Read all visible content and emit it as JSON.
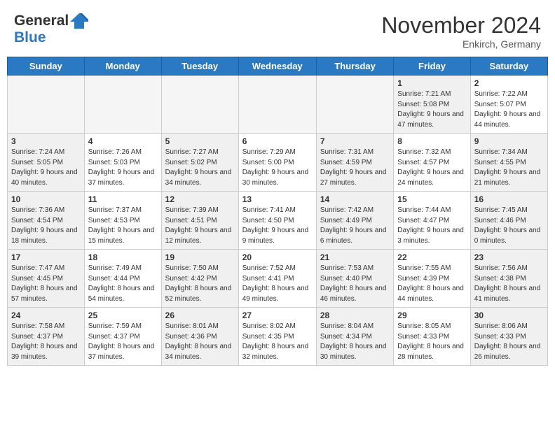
{
  "header": {
    "logo_line1": "General",
    "logo_line2": "Blue",
    "month_title": "November 2024",
    "location": "Enkirch, Germany"
  },
  "days_of_week": [
    "Sunday",
    "Monday",
    "Tuesday",
    "Wednesday",
    "Thursday",
    "Friday",
    "Saturday"
  ],
  "weeks": [
    [
      {
        "day": "",
        "info": "",
        "empty": true
      },
      {
        "day": "",
        "info": "",
        "empty": true
      },
      {
        "day": "",
        "info": "",
        "empty": true
      },
      {
        "day": "",
        "info": "",
        "empty": true
      },
      {
        "day": "",
        "info": "",
        "empty": true
      },
      {
        "day": "1",
        "info": "Sunrise: 7:21 AM\nSunset: 5:08 PM\nDaylight: 9 hours and 47 minutes.",
        "empty": false,
        "shaded": true
      },
      {
        "day": "2",
        "info": "Sunrise: 7:22 AM\nSunset: 5:07 PM\nDaylight: 9 hours and 44 minutes.",
        "empty": false
      }
    ],
    [
      {
        "day": "3",
        "info": "Sunrise: 7:24 AM\nSunset: 5:05 PM\nDaylight: 9 hours and 40 minutes.",
        "empty": false,
        "shaded": true
      },
      {
        "day": "4",
        "info": "Sunrise: 7:26 AM\nSunset: 5:03 PM\nDaylight: 9 hours and 37 minutes.",
        "empty": false
      },
      {
        "day": "5",
        "info": "Sunrise: 7:27 AM\nSunset: 5:02 PM\nDaylight: 9 hours and 34 minutes.",
        "empty": false,
        "shaded": true
      },
      {
        "day": "6",
        "info": "Sunrise: 7:29 AM\nSunset: 5:00 PM\nDaylight: 9 hours and 30 minutes.",
        "empty": false
      },
      {
        "day": "7",
        "info": "Sunrise: 7:31 AM\nSunset: 4:59 PM\nDaylight: 9 hours and 27 minutes.",
        "empty": false,
        "shaded": true
      },
      {
        "day": "8",
        "info": "Sunrise: 7:32 AM\nSunset: 4:57 PM\nDaylight: 9 hours and 24 minutes.",
        "empty": false
      },
      {
        "day": "9",
        "info": "Sunrise: 7:34 AM\nSunset: 4:55 PM\nDaylight: 9 hours and 21 minutes.",
        "empty": false,
        "shaded": true
      }
    ],
    [
      {
        "day": "10",
        "info": "Sunrise: 7:36 AM\nSunset: 4:54 PM\nDaylight: 9 hours and 18 minutes.",
        "empty": false,
        "shaded": true
      },
      {
        "day": "11",
        "info": "Sunrise: 7:37 AM\nSunset: 4:53 PM\nDaylight: 9 hours and 15 minutes.",
        "empty": false
      },
      {
        "day": "12",
        "info": "Sunrise: 7:39 AM\nSunset: 4:51 PM\nDaylight: 9 hours and 12 minutes.",
        "empty": false,
        "shaded": true
      },
      {
        "day": "13",
        "info": "Sunrise: 7:41 AM\nSunset: 4:50 PM\nDaylight: 9 hours and 9 minutes.",
        "empty": false
      },
      {
        "day": "14",
        "info": "Sunrise: 7:42 AM\nSunset: 4:49 PM\nDaylight: 9 hours and 6 minutes.",
        "empty": false,
        "shaded": true
      },
      {
        "day": "15",
        "info": "Sunrise: 7:44 AM\nSunset: 4:47 PM\nDaylight: 9 hours and 3 minutes.",
        "empty": false
      },
      {
        "day": "16",
        "info": "Sunrise: 7:45 AM\nSunset: 4:46 PM\nDaylight: 9 hours and 0 minutes.",
        "empty": false,
        "shaded": true
      }
    ],
    [
      {
        "day": "17",
        "info": "Sunrise: 7:47 AM\nSunset: 4:45 PM\nDaylight: 8 hours and 57 minutes.",
        "empty": false,
        "shaded": true
      },
      {
        "day": "18",
        "info": "Sunrise: 7:49 AM\nSunset: 4:44 PM\nDaylight: 8 hours and 54 minutes.",
        "empty": false
      },
      {
        "day": "19",
        "info": "Sunrise: 7:50 AM\nSunset: 4:42 PM\nDaylight: 8 hours and 52 minutes.",
        "empty": false,
        "shaded": true
      },
      {
        "day": "20",
        "info": "Sunrise: 7:52 AM\nSunset: 4:41 PM\nDaylight: 8 hours and 49 minutes.",
        "empty": false
      },
      {
        "day": "21",
        "info": "Sunrise: 7:53 AM\nSunset: 4:40 PM\nDaylight: 8 hours and 46 minutes.",
        "empty": false,
        "shaded": true
      },
      {
        "day": "22",
        "info": "Sunrise: 7:55 AM\nSunset: 4:39 PM\nDaylight: 8 hours and 44 minutes.",
        "empty": false
      },
      {
        "day": "23",
        "info": "Sunrise: 7:56 AM\nSunset: 4:38 PM\nDaylight: 8 hours and 41 minutes.",
        "empty": false,
        "shaded": true
      }
    ],
    [
      {
        "day": "24",
        "info": "Sunrise: 7:58 AM\nSunset: 4:37 PM\nDaylight: 8 hours and 39 minutes.",
        "empty": false,
        "shaded": true
      },
      {
        "day": "25",
        "info": "Sunrise: 7:59 AM\nSunset: 4:37 PM\nDaylight: 8 hours and 37 minutes.",
        "empty": false
      },
      {
        "day": "26",
        "info": "Sunrise: 8:01 AM\nSunset: 4:36 PM\nDaylight: 8 hours and 34 minutes.",
        "empty": false,
        "shaded": true
      },
      {
        "day": "27",
        "info": "Sunrise: 8:02 AM\nSunset: 4:35 PM\nDaylight: 8 hours and 32 minutes.",
        "empty": false
      },
      {
        "day": "28",
        "info": "Sunrise: 8:04 AM\nSunset: 4:34 PM\nDaylight: 8 hours and 30 minutes.",
        "empty": false,
        "shaded": true
      },
      {
        "day": "29",
        "info": "Sunrise: 8:05 AM\nSunset: 4:33 PM\nDaylight: 8 hours and 28 minutes.",
        "empty": false
      },
      {
        "day": "30",
        "info": "Sunrise: 8:06 AM\nSunset: 4:33 PM\nDaylight: 8 hours and 26 minutes.",
        "empty": false,
        "shaded": true
      }
    ]
  ]
}
